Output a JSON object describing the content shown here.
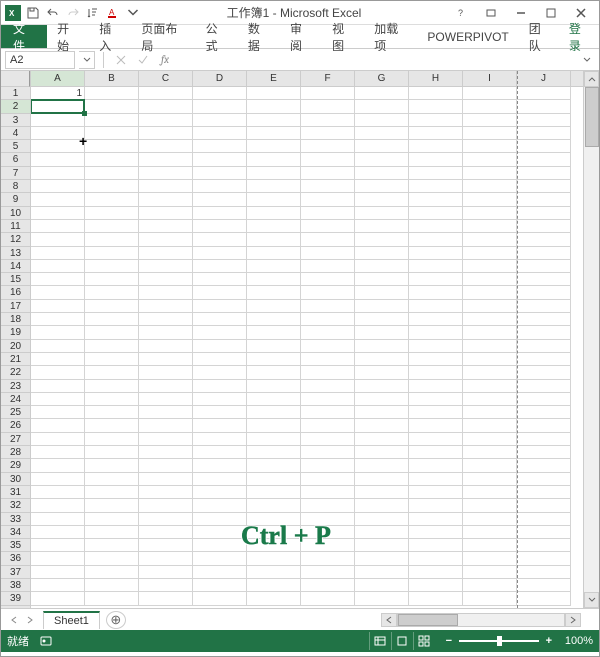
{
  "titlebar": {
    "title": "工作簿1 - Microsoft Excel"
  },
  "ribbon": {
    "file": "文件",
    "tabs": [
      "开始",
      "插入",
      "页面布局",
      "公式",
      "数据",
      "审阅",
      "视图",
      "加载项",
      "POWERPIVOT",
      "团队"
    ],
    "login": "登录"
  },
  "formula_bar": {
    "name_box": "A2",
    "fx_label": "fx",
    "formula": ""
  },
  "grid": {
    "columns": [
      "A",
      "B",
      "C",
      "D",
      "E",
      "F",
      "G",
      "H",
      "I",
      "J"
    ],
    "row_count": 39,
    "selected_cell": "A2",
    "selected_row": 2,
    "selected_col": "A",
    "cells": {
      "A1": "1"
    },
    "page_break_after_col": "I"
  },
  "overlay": {
    "shortcut_text": "Ctrl + P"
  },
  "sheet_tabs": {
    "active": "Sheet1"
  },
  "statusbar": {
    "mode": "就绪",
    "zoom": "100%"
  }
}
